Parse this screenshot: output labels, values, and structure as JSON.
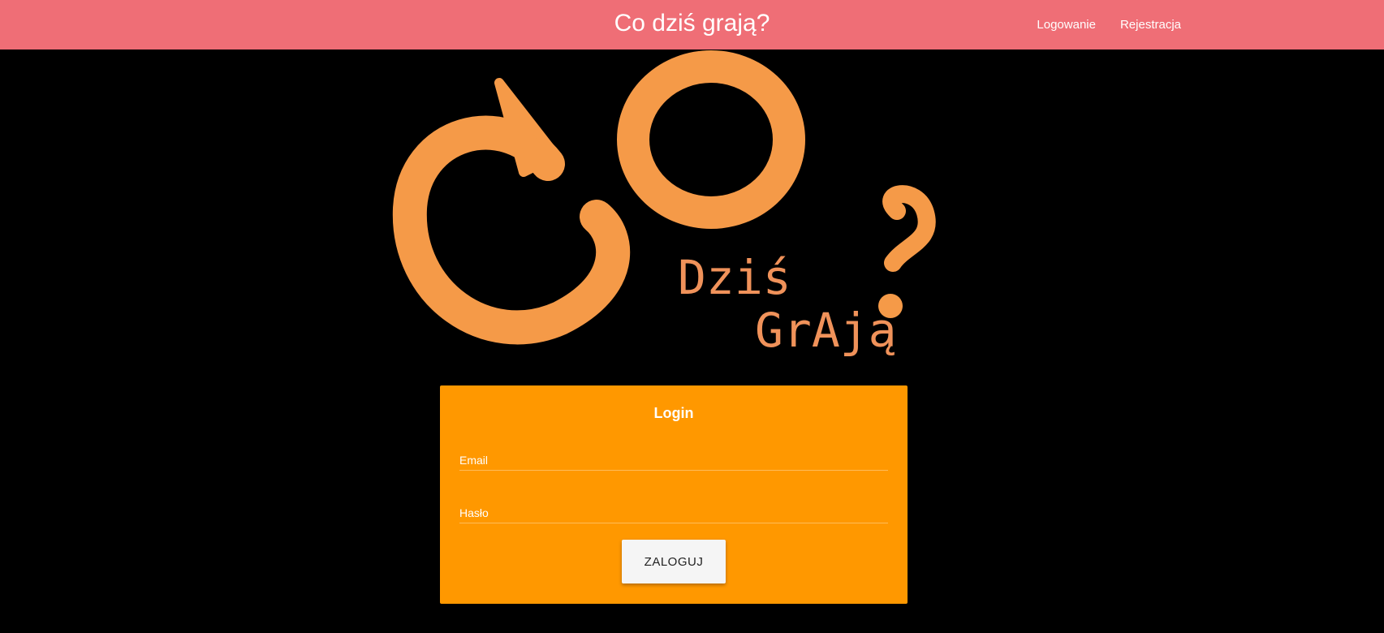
{
  "navbar": {
    "brand": "Co dziś grają?",
    "links": [
      "Logowanie",
      "Rejestracja"
    ],
    "background": "#ef6e76"
  },
  "logo": {
    "line1": "Dziś",
    "line2": "GrAją",
    "color": "#f59a48"
  },
  "login": {
    "title": "Login",
    "email_label": "Email",
    "password_label": "Hasło",
    "submit_label": "ZALOGUJ",
    "background": "#ff9800"
  }
}
